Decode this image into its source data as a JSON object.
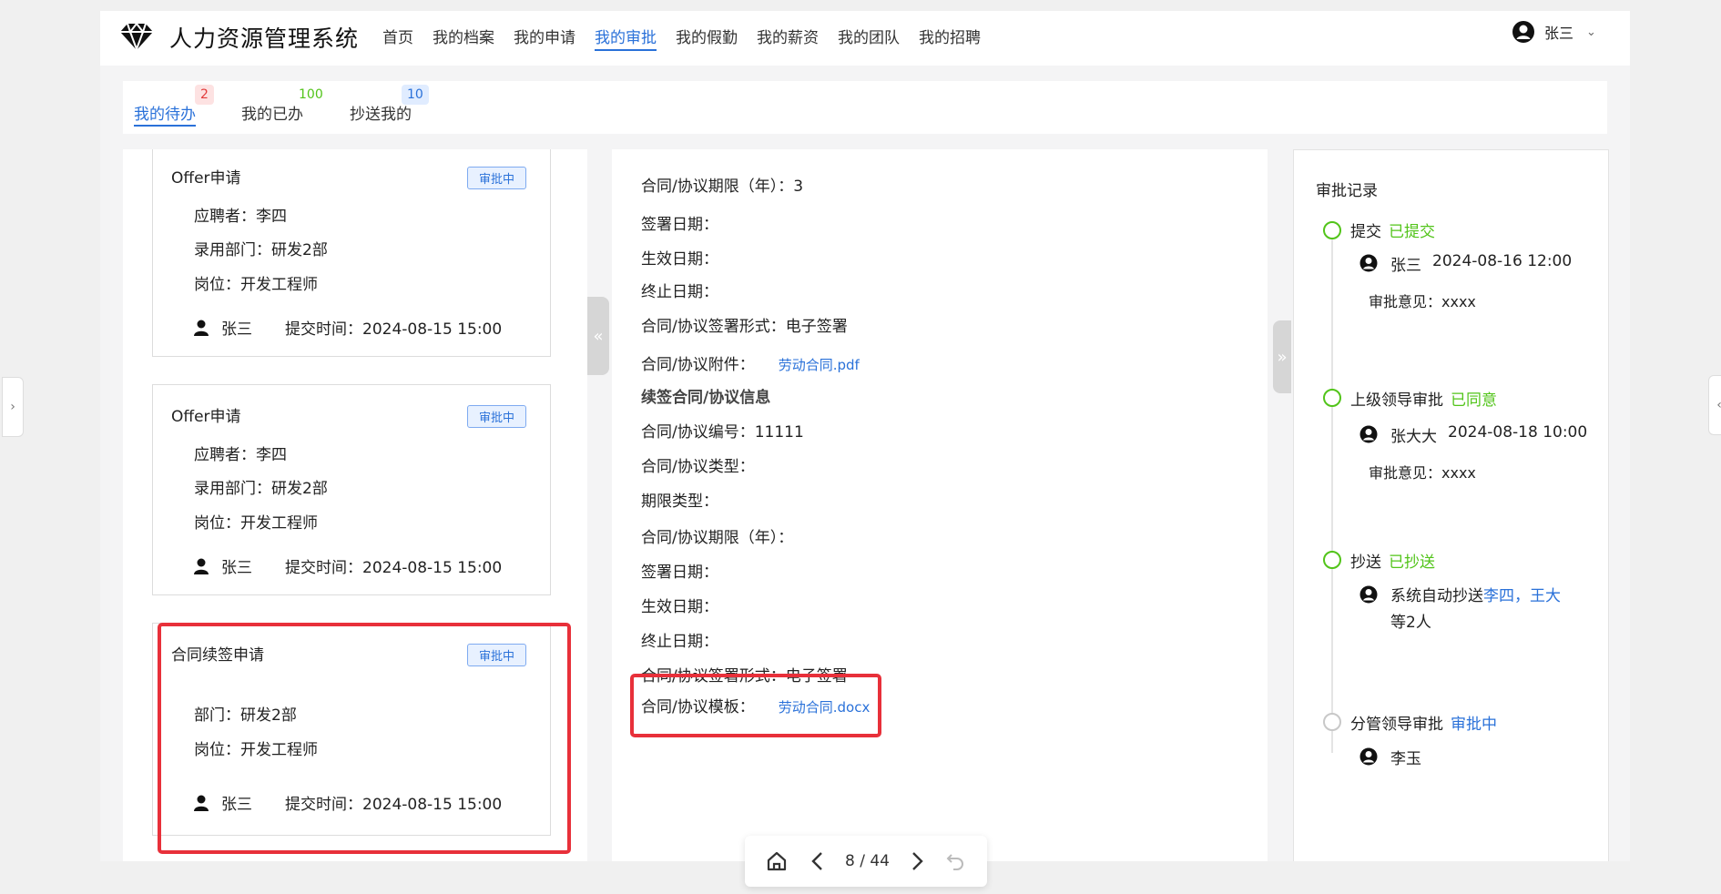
{
  "app": {
    "title": "人力资源管理系统"
  },
  "nav": {
    "items": [
      "首页",
      "我的档案",
      "我的申请",
      "我的审批",
      "我的假勤",
      "我的薪资",
      "我的团队",
      "我的招聘"
    ],
    "active_index": 3
  },
  "user": {
    "name": "张三"
  },
  "tabs": [
    {
      "label": "我的待办",
      "count": "2"
    },
    {
      "label": "我的已办",
      "count": "100"
    },
    {
      "label": "抄送我的",
      "count": "10"
    }
  ],
  "cards": [
    {
      "title": "Offer申请",
      "status": "审批中",
      "fields": [
        "应聘者：李四",
        "录用部门：研发2部",
        "岗位：开发工程师"
      ],
      "applicant": "张三",
      "submit_time": "提交时间：2024-08-15 15:00"
    },
    {
      "title": "Offer申请",
      "status": "审批中",
      "fields": [
        "应聘者：李四",
        "录用部门：研发2部",
        "岗位：开发工程师"
      ],
      "applicant": "张三",
      "submit_time": "提交时间：2024-08-15 15:00"
    },
    {
      "title": "合同续签申请",
      "status": "审批中",
      "fields": [
        "部门：研发2部",
        "岗位：开发工程师"
      ],
      "applicant": "张三",
      "submit_time": "提交时间：2024-08-15 15:00"
    }
  ],
  "detail": {
    "rows": [
      "合同/协议期限（年）：3",
      "签署日期：",
      "生效日期：",
      "终止日期：",
      "合同/协议签署形式：电子签署"
    ],
    "attachment_label": "合同/协议附件：",
    "attachment_file": "劳动合同.pdf",
    "section_title": "续签合同/协议信息",
    "renew_rows": [
      "合同/协议编号：11111",
      "合同/协议类型：",
      "期限类型：",
      "合同/协议期限（年）：",
      "签署日期：",
      "生效日期：",
      "终止日期：",
      "合同/协议签署形式：电子签署"
    ],
    "template_label": "合同/协议模板：",
    "template_file": "劳动合同.docx"
  },
  "record": {
    "title": "审批记录",
    "steps": [
      {
        "name": "提交",
        "status": "已提交",
        "person": "张三",
        "time": "2024-08-16 12:00",
        "comment": "审批意见：xxxx"
      },
      {
        "name": "上级领导审批",
        "status": "已同意",
        "person": "张大大",
        "time": "2024-08-18 10:00",
        "comment": "审批意见：xxxx"
      },
      {
        "name": "抄送",
        "status": "已抄送",
        "cc_prefix": "系统自动抄送",
        "cc_names": "李四，王大",
        "cc_suffix": "等2人"
      },
      {
        "name": "分管领导审批",
        "status": "审批中",
        "person": "李玉"
      }
    ]
  },
  "pager": {
    "current": "8 / 44"
  },
  "icons": {
    "logo": "diamond-logo-icon",
    "user": "user-circle-icon",
    "person": "person-icon",
    "home": "home-icon",
    "prev": "chevron-left-icon",
    "next": "chevron-right-icon",
    "undo": "undo-icon"
  },
  "colors": {
    "accent": "#2a71d9",
    "success": "#52c41a",
    "danger": "#e8303a"
  }
}
